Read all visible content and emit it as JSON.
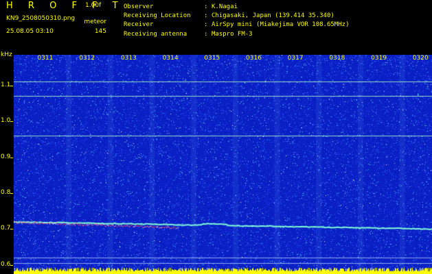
{
  "app": {
    "title": "H R O F F T",
    "version": "1.00f",
    "filename": "KN9_2508050310.png",
    "datetime": "25.08.05 03:10",
    "mode": "meteor",
    "count": "145"
  },
  "info": {
    "labels": [
      "Observer",
      "Receiving Location",
      "Receiver",
      "Receiving antenna"
    ],
    "separator": ":",
    "values": [
      "K.Nagai",
      "Chigasaki, Japan (139.414 35.340)",
      "AirSpy mini (Miakejima VOR 108.65MHz)",
      "Maspro FM-3"
    ]
  },
  "axis": {
    "unit": "kHz",
    "y_labels": [
      "1.1",
      "1.0",
      "0.9",
      "0.8",
      "0.7",
      "0.6"
    ],
    "y_values": [
      1.1,
      1.0,
      0.9,
      0.8,
      0.7,
      0.6
    ],
    "y_range": [
      0.575,
      1.185
    ],
    "time_labels": [
      "0311",
      "0312",
      "0313",
      "0314",
      "0315",
      "0316",
      "0317",
      "0318",
      "0319",
      "0320"
    ]
  },
  "spectrogram": {
    "background": "#0a1fc4",
    "noise_colors": [
      "#2a4fff",
      "#3fa0ff",
      "#7fe0ff",
      "#ffffff"
    ],
    "tone_lines_khz": [
      1.11,
      1.07,
      0.96,
      0.62,
      0.605
    ],
    "carrier_khz_start": 0.72,
    "carrier_khz_end": 0.7,
    "carrier_color": "#7fffd4",
    "meteor_color": "#ff3060",
    "bottom_bar_color": "#ffff00"
  }
}
